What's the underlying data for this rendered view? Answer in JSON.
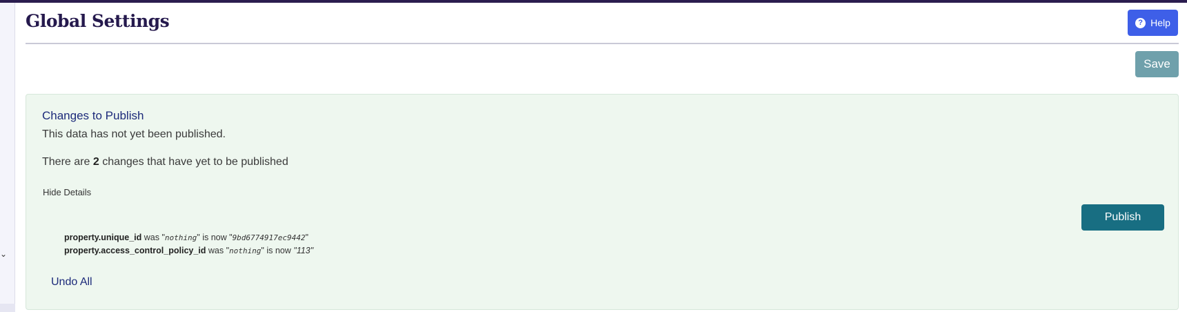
{
  "header": {
    "title": "Global Settings",
    "help_label": "Help",
    "help_icon_glyph": "?"
  },
  "toolbar": {
    "save_label": "Save"
  },
  "panel": {
    "heading": "Changes to Publish",
    "status_text": "This data has not yet been published.",
    "count_prefix": "There are",
    "count": "2",
    "count_suffix": "changes that have yet to be published",
    "hide_details_label": "Hide Details",
    "publish_label": "Publish",
    "undo_all_label": "Undo All",
    "changes": [
      {
        "field": "property.unique_id",
        "was_text": "was",
        "old_value": "nothing",
        "now_text": "is now",
        "new_value": "9bd6774917ec9442"
      },
      {
        "field": "property.access_control_policy_id",
        "was_text": "was",
        "old_value": "nothing",
        "now_text": "is now",
        "new_value": "113"
      }
    ]
  },
  "colors": {
    "title": "#25194d",
    "help_button": "#3e5fe8",
    "save_button": "#6fa0ab",
    "publish_button": "#186e82",
    "panel_bg": "#eef7ef",
    "link": "#1c2a7a"
  },
  "icons": {
    "help": "question-circle-icon",
    "sidebar_chevron": "chevron-down-icon"
  }
}
